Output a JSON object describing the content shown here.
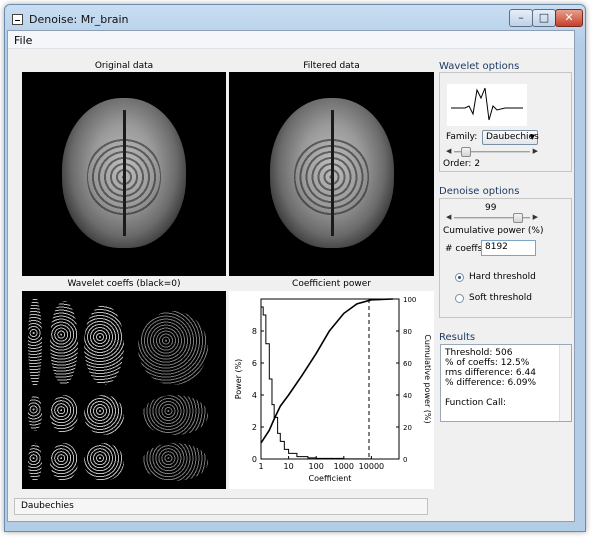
{
  "window": {
    "title": "Denoise: Mr_brain",
    "minimize": "–",
    "maximize": "□",
    "close": "✕"
  },
  "menu": {
    "file": "File"
  },
  "panels": {
    "original": "Original data",
    "filtered": "Filtered data",
    "coeffs": "Wavelet coeffs (black=0)",
    "power": "Coefficient power"
  },
  "wavelet_options": {
    "title": "Wavelet options",
    "family_label": "Family:",
    "family_value": "Daubechies",
    "order_label": "Order:",
    "order_value": "2",
    "order_slider": 0.1
  },
  "denoise_options": {
    "title": "Denoise options",
    "power_value": "99",
    "power_slider": 0.9,
    "cumulative_label": "Cumulative power (%)",
    "coeffs_label": "# coeffs",
    "coeffs_value": "8192",
    "hard_label": "Hard threshold",
    "soft_label": "Soft threshold",
    "selected": "hard"
  },
  "results": {
    "title": "Results",
    "lines": [
      "Threshold: 506",
      "% of coeffs: 12.5%",
      "rms difference: 6.44",
      "% difference: 6.09%",
      "",
      "Function Call:"
    ]
  },
  "status": {
    "text": "Daubechies"
  },
  "chart_data": {
    "type": "line",
    "title": "Coefficient power",
    "xlabel": "Coefficient",
    "ylabel": "Power (%)",
    "y2label": "Cumulative power (%)",
    "x_scale": "log",
    "xlim": [
      1,
      100000
    ],
    "ylim": [
      0,
      10
    ],
    "y2lim": [
      0,
      100
    ],
    "x_ticks": [
      "1",
      "10",
      "100",
      "1000",
      "10000"
    ],
    "y_ticks": [
      "0",
      "2",
      "4",
      "6",
      "8"
    ],
    "y2_ticks": [
      "0",
      "20",
      "40",
      "60",
      "80",
      "100"
    ],
    "threshold_x": 8192,
    "series": [
      {
        "axis": "left",
        "x": [
          1,
          1.2,
          1.5,
          2,
          2.5,
          3,
          4,
          5,
          7,
          10,
          20,
          50,
          100,
          1000,
          10000,
          60000
        ],
        "values": [
          9.5,
          9.0,
          7.2,
          5.0,
          3.4,
          2.6,
          1.6,
          1.1,
          0.6,
          0.35,
          0.15,
          0.07,
          0.04,
          0.01,
          0.003,
          0.001
        ]
      },
      {
        "axis": "right",
        "x": [
          1,
          2,
          3,
          5,
          10,
          30,
          100,
          300,
          1000,
          3000,
          10000,
          60000
        ],
        "values": [
          10,
          18,
          25,
          33,
          40,
          52,
          66,
          80,
          91,
          97,
          99.5,
          100
        ]
      }
    ]
  }
}
